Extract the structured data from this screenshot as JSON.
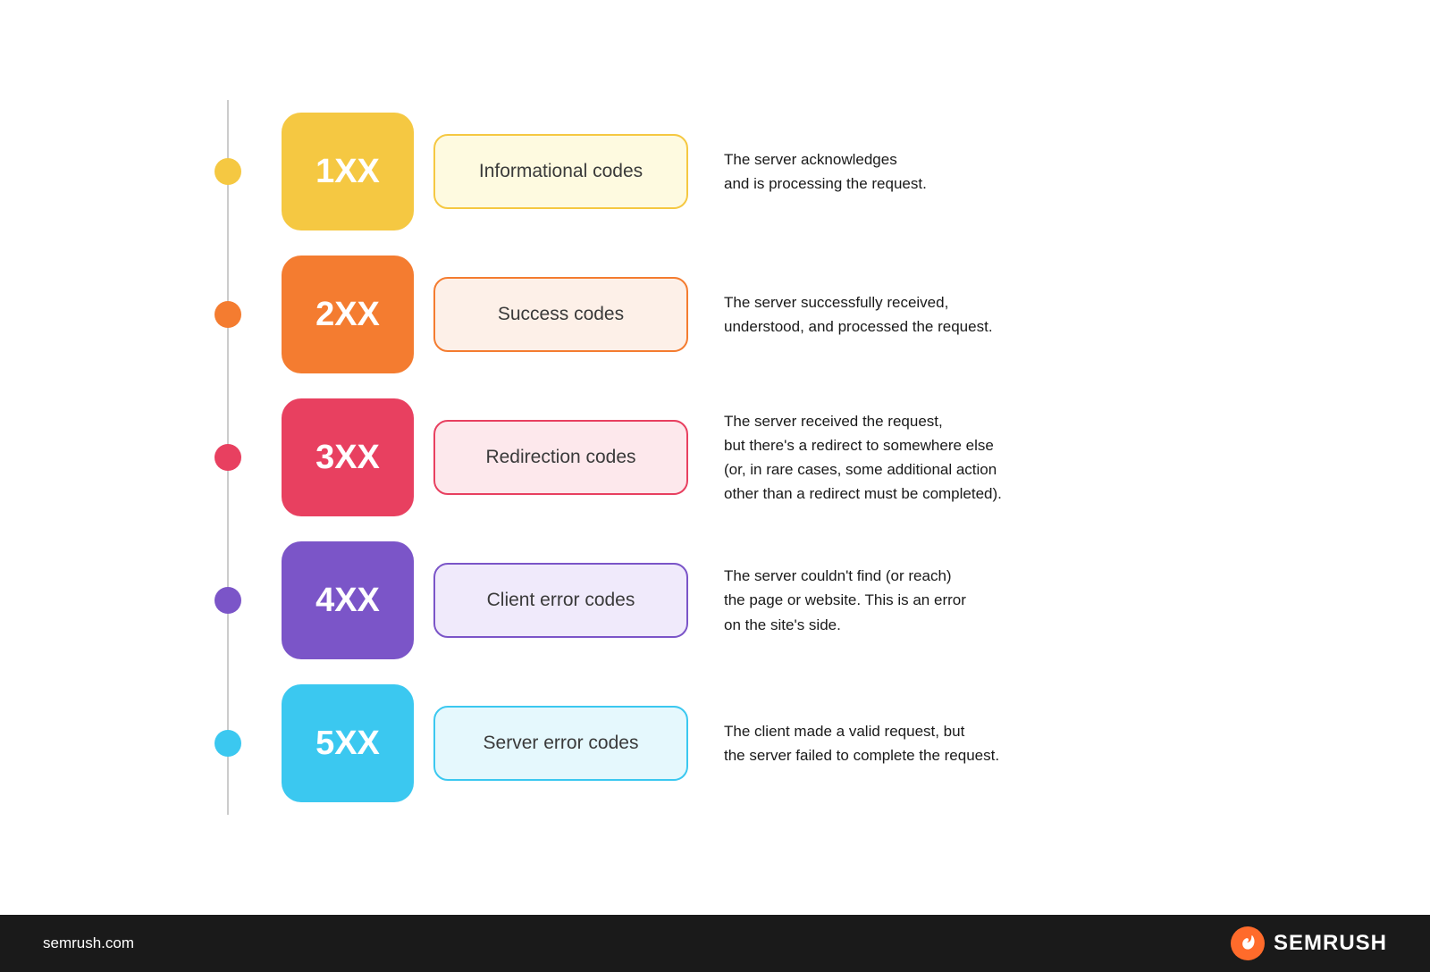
{
  "rows": [
    {
      "id": "1xx",
      "dot_color": "#F5C842",
      "code_label": "1XX",
      "code_bg": "#F5C842",
      "label_text": "Informational codes",
      "label_bg": "#FEFAE0",
      "label_border": "#F5C842",
      "label_color": "#3a3a3a",
      "description": "The server acknowledges\nand is processing the request."
    },
    {
      "id": "2xx",
      "dot_color": "#F47C30",
      "code_label": "2XX",
      "code_bg": "#F47C30",
      "label_text": "Success codes",
      "label_bg": "#FDF0E8",
      "label_border": "#F47C30",
      "label_color": "#3a3a3a",
      "description": "The server successfully received,\nunderstood, and processed the request."
    },
    {
      "id": "3xx",
      "dot_color": "#E84060",
      "code_label": "3XX",
      "code_bg": "#E84060",
      "label_text": "Redirection codes",
      "label_bg": "#FDE8EC",
      "label_border": "#E84060",
      "label_color": "#3a3a3a",
      "description": "The server received the request,\nbut there's a redirect to somewhere else\n(or, in rare cases, some additional action\nother than a redirect must be completed)."
    },
    {
      "id": "4xx",
      "dot_color": "#7B55C8",
      "code_label": "4XX",
      "code_bg": "#7B55C8",
      "label_text": "Client error codes",
      "label_bg": "#F0EAFB",
      "label_border": "#7B55C8",
      "label_color": "#3a3a3a",
      "description": "The server couldn't find (or reach)\nthe page or website. This is an error\non the site's side."
    },
    {
      "id": "5xx",
      "dot_color": "#3BC8F0",
      "code_label": "5XX",
      "code_bg": "#3BC8F0",
      "label_text": "Server error codes",
      "label_bg": "#E5F8FD",
      "label_border": "#3BC8F0",
      "label_color": "#3a3a3a",
      "description": "The client made a valid request, but\nthe server failed to complete the request."
    }
  ],
  "footer": {
    "url": "semrush.com",
    "brand": "SEMRUSH"
  }
}
